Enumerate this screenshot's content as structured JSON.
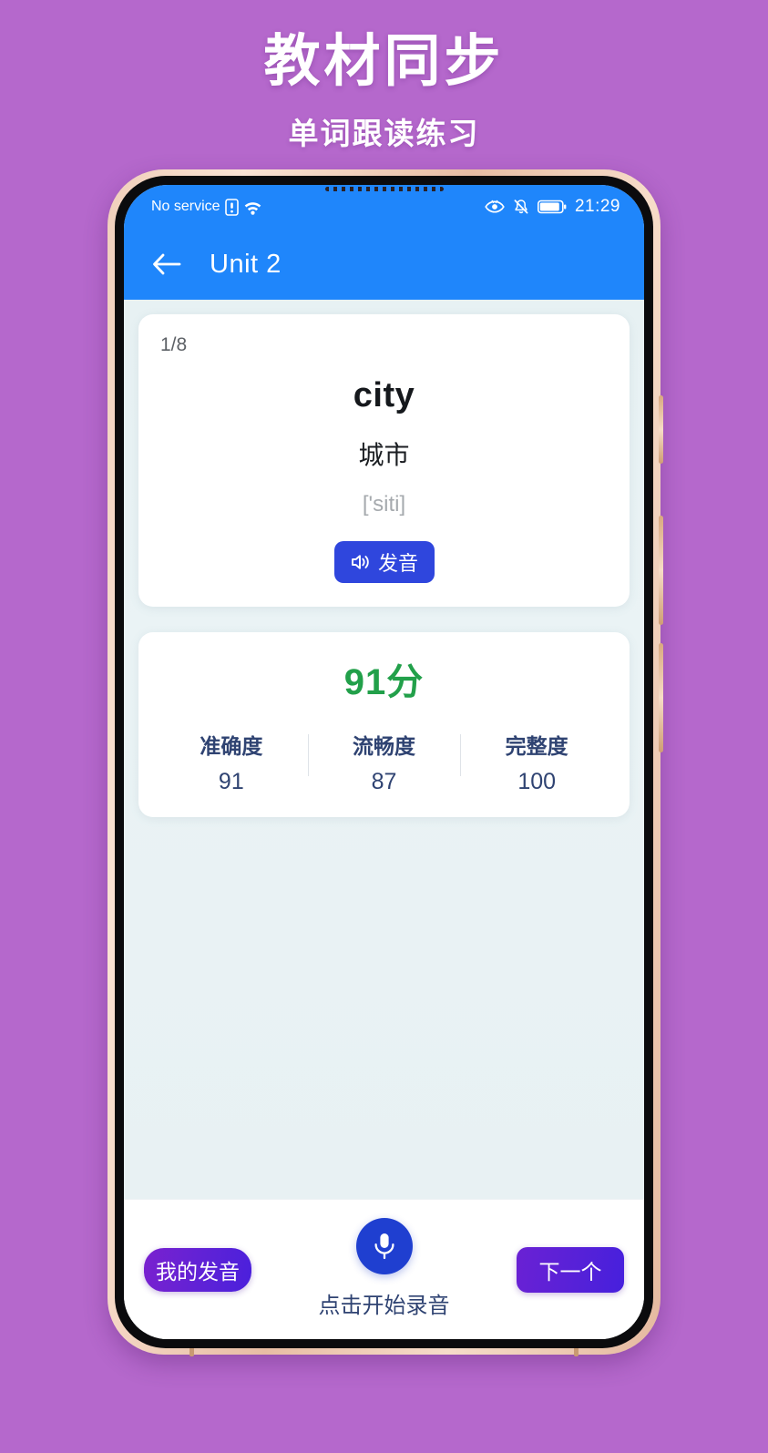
{
  "promo": {
    "title": "教材同步",
    "subtitle": "单词跟读练习"
  },
  "colors": {
    "page_background": "#b568cc",
    "appbar": "#1f86fb",
    "score_green": "#22a04a",
    "speak_blue": "#2f46dd",
    "mic_blue": "#1f3fd0",
    "pill_purple": "#5f22d6",
    "screen_background": "#e9f2f4"
  },
  "statusbar": {
    "carrier": "No service",
    "sim_icon": "sim-alert-icon",
    "wifi_icon": "wifi-icon",
    "eye_icon": "eye-icon",
    "bell_icon": "bell-muted-icon",
    "battery_icon": "battery-icon",
    "time": "21:29"
  },
  "appbar": {
    "back_icon": "back-arrow-icon",
    "title": "Unit 2"
  },
  "word_card": {
    "counter": "1/8",
    "word": "city",
    "translation": "城市",
    "phonetic": "['siti]",
    "speak_button": {
      "icon": "speaker-icon",
      "label": "发音"
    }
  },
  "score_card": {
    "total": "91分",
    "metrics": [
      {
        "label": "准确度",
        "value": "91"
      },
      {
        "label": "流畅度",
        "value": "87"
      },
      {
        "label": "完整度",
        "value": "100"
      }
    ]
  },
  "bottombar": {
    "my_recording_label": "我的发音",
    "mic_icon": "microphone-icon",
    "mic_hint": "点击开始录音",
    "next_label": "下一个"
  }
}
